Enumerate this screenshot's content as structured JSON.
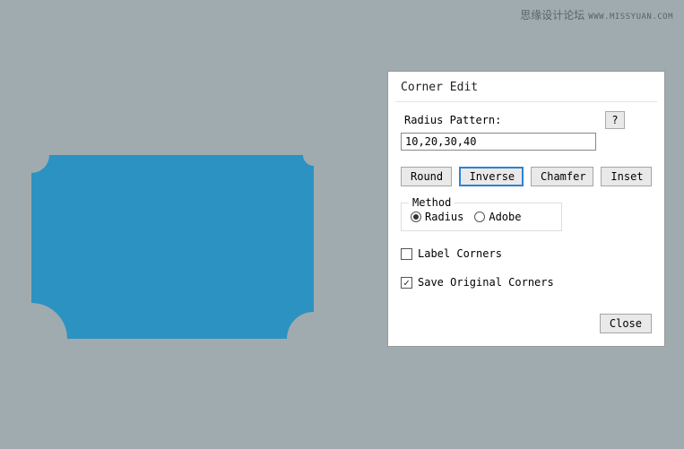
{
  "watermark": {
    "text": "思缘设计论坛",
    "url": "WWW.MISSYUAN.COM"
  },
  "shape": {
    "fill": "#2c92c2"
  },
  "dialog": {
    "title": "Corner Edit",
    "radius_label": "Radius Pattern:",
    "help_label": "?",
    "radius_value": "10,20,30,40",
    "buttons": {
      "round": "Round",
      "inverse": "Inverse",
      "chamfer": "Chamfer",
      "inset": "Inset"
    },
    "method": {
      "legend": "Method",
      "radius": "Radius",
      "adobe": "Adobe"
    },
    "label_corners": "Label Corners",
    "save_original": "Save Original Corners",
    "close": "Close"
  }
}
